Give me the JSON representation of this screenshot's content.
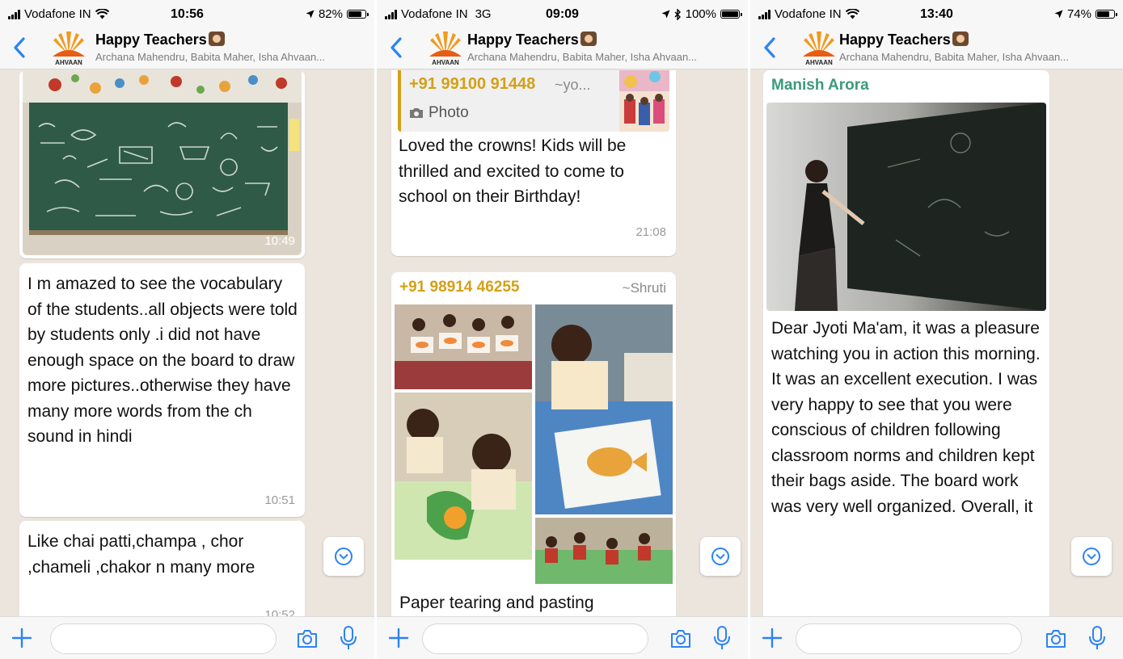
{
  "screens": [
    {
      "status": {
        "carrier": "Vodafone IN",
        "network": "",
        "time": "10:56",
        "battery": "82%",
        "battery_level": 0.82
      },
      "header": {
        "title": "Happy Teachers",
        "members": "Archana Mahendru, Babita Maher, Isha Ahvaan...",
        "logo_text": "AHVAAN"
      },
      "messages": [
        {
          "type": "image",
          "time": "10:49"
        },
        {
          "type": "text",
          "text": "I m amazed to see the vocabulary of the students..all objects were told by students only .i did not have enough space on the board to draw more pictures..otherwise they have many more words from the ch sound in hindi",
          "time": "10:51"
        },
        {
          "type": "text",
          "text": "Like chai patti,champa , chor ,chameli ,chakor n many more",
          "time": "10:52"
        }
      ]
    },
    {
      "status": {
        "carrier": "Vodafone IN",
        "network": "3G",
        "time": "09:09",
        "battery": "100%",
        "battery_level": 1.0
      },
      "header": {
        "title": "Happy Teachers",
        "members": "Archana Mahendru, Babita Maher, Isha Ahvaan...",
        "logo_text": "AHVAAN"
      },
      "messages": [
        {
          "type": "reply",
          "quoted_sender": "+91 99100 91448",
          "quoted_alias": "~yo...",
          "quoted_kind": "Photo",
          "text": "Loved the crowns! Kids will be thrilled and excited to come to school on their Birthday!",
          "time": "21:08"
        },
        {
          "type": "album",
          "sender": "+91 98914 46255",
          "alias": "~Shruti",
          "caption": "Paper tearing and pasting"
        }
      ]
    },
    {
      "status": {
        "carrier": "Vodafone IN",
        "network": "",
        "time": "13:40",
        "battery": "74%",
        "battery_level": 0.74
      },
      "header": {
        "title": "Happy Teachers",
        "members": "Archana Mahendru, Babita Maher, Isha Ahvaan...",
        "logo_text": "AHVAAN"
      },
      "messages": [
        {
          "type": "image_text",
          "sender": "Manish Arora",
          "text": "Dear Jyoti Ma'am, it was a pleasure watching you in action this morning. It was an excellent execution. I was very happy to see that you were conscious of children following classroom norms and children kept their bags aside. The board work was very well organized. Overall, it"
        }
      ]
    }
  ],
  "colors": {
    "accent": "#2c83f5",
    "chat_bg": "#ece5dd",
    "sender_green": "#3b9a7a",
    "sender_gold": "#d3a017",
    "time_grey": "#9a9a9a"
  },
  "icons": [
    "back-chevron-icon",
    "group-logo-icon",
    "plus-icon",
    "camera-icon",
    "microphone-icon",
    "scroll-down-icon",
    "camera-small-icon",
    "location-arrow-icon",
    "bluetooth-icon",
    "wifi-icon"
  ]
}
